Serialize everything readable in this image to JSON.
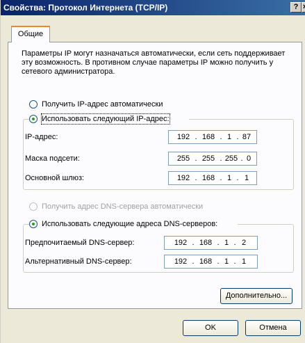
{
  "window": {
    "title": "Свойства: Протокол Интернета (TCP/IP)",
    "help_glyph": "?",
    "close_glyph": "×"
  },
  "tabs": [
    {
      "label": "Общие",
      "selected": true
    }
  ],
  "description": "Параметры IP могут назначаться автоматически, если сеть поддерживает эту возможность. В противном случае параметры IP можно получить у сетевого администратора.",
  "ip": {
    "auto_label": "Получить IP-адрес автоматически",
    "manual_label": "Использовать следующий IP-адрес:",
    "selected": "manual",
    "fields": [
      {
        "label": "IP-адрес:",
        "octets": [
          "192",
          "168",
          "1",
          "87"
        ]
      },
      {
        "label": "Маска подсети:",
        "octets": [
          "255",
          "255",
          "255",
          "0"
        ]
      },
      {
        "label": "Основной шлюз:",
        "octets": [
          "192",
          "168",
          "1",
          "1"
        ]
      }
    ]
  },
  "dns": {
    "auto_label": "Получить адрес DNS-сервера автоматически",
    "manual_label": "Использовать следующие адреса DNS-серверов:",
    "selected": "manual",
    "fields": [
      {
        "label": "Предпочитаемый DNS-сервер:",
        "octets": [
          "192",
          "168",
          "1",
          "2"
        ]
      },
      {
        "label": "Альтернативный DNS-сервер:",
        "octets": [
          "192",
          "168",
          "1",
          "1"
        ]
      }
    ]
  },
  "buttons": {
    "advanced": "Дополнительно...",
    "ok": "OK",
    "cancel": "Отмена"
  }
}
